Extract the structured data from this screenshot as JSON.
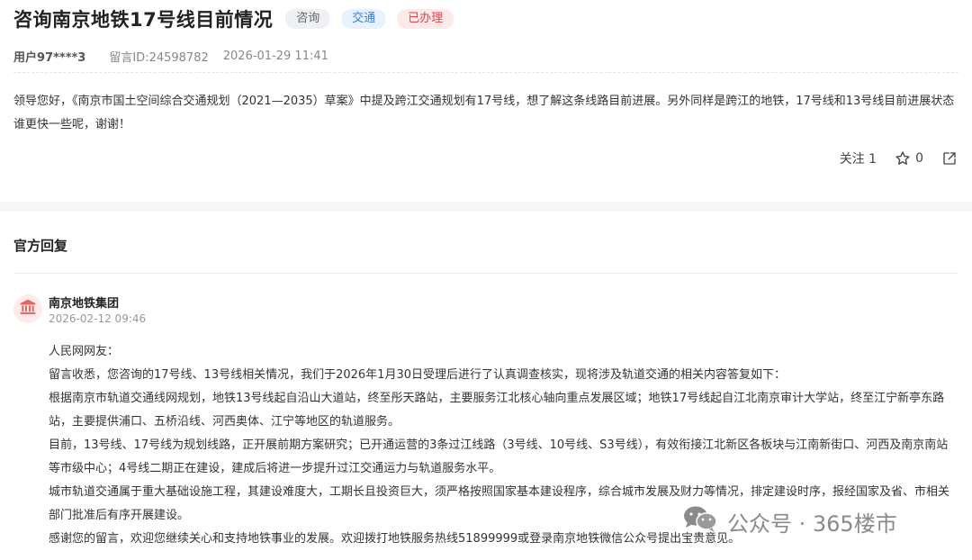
{
  "header": {
    "title": "咨询南京地铁17号线目前情况",
    "tags": [
      "咨询",
      "交通",
      "已办理"
    ]
  },
  "meta": {
    "user": "用户97****3",
    "message_id": "留言ID:24598782",
    "datetime": "2026-01-29 11:41"
  },
  "question": {
    "text": "领导您好，《南京市国土空间综合交通规划（2021—2035）草案》中提及跨江交通规划有17号线，想了解这条线路目前进展。另外同样是跨江的地铁，17号线和13号线目前进展状态谁更快一些呢，谢谢！"
  },
  "actions": {
    "follow_label": "关注 1",
    "star_count": "0",
    "icons": [
      "star-icon",
      "share-icon"
    ]
  },
  "reply": {
    "section_title": "官方回复",
    "org_name": "南京地铁集团",
    "date": "2026-02-12 09:46",
    "paragraphs": [
      "人民网网友：",
      "留言收悉，您咨询的17号线、13号线相关情况，我们于2026年1月30日受理后进行了认真调查核实，现将涉及轨道交通的相关内容答复如下：",
      "根据南京市轨道交通线网规划，地铁13号线起自沿山大道站，终至彤天路站，主要服务江北核心轴向重点发展区域；地铁17号线起自江北南京审计大学站，终至江宁新亭东路站，主要提供浦口、五桥沿线、河西奥体、江宁等地区的轨道服务。",
      "目前，13号线、17号线为规划线路，正开展前期方案研究；已开通运营的3条过江线路（3号线、10号线、S3号线），有效衔接江北新区各板块与江南新街口、河西及南京南站等市级中心；4号线二期正在建设，建成后将进一步提升过江交通运力与轨道服务水平。",
      "城市轨道交通属于重大基础设施工程，其建设难度大，工期长且投资巨大，须严格按照国家基本建设程序，综合城市发展及财力等情况，排定建设时序，报经国家及省、市相关部门批准后有序开展建设。",
      "感谢您的留言，欢迎您继续关心和支持地铁事业的发展。欢迎拨打地铁服务热线51899999或登录南京地铁微信公众号提出宝贵意见。"
    ]
  },
  "watermark": {
    "text": "公众号 · 365楼市"
  },
  "colors": {
    "accent_blue": "#3a7fd5",
    "status_red": "#e0454b",
    "avatar_bg": "#fdeceb"
  }
}
